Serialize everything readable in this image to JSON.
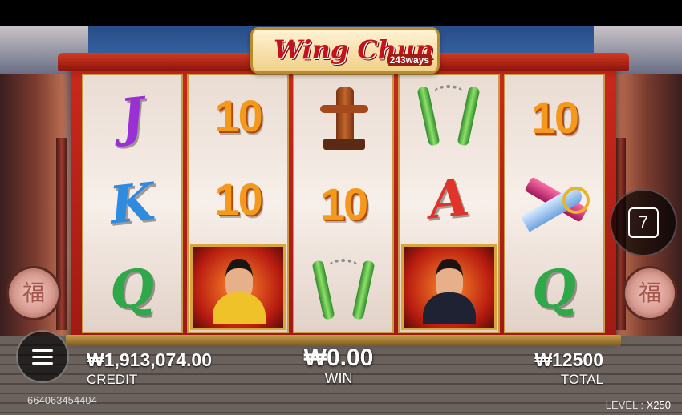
{
  "title": {
    "name": "Wing Chun",
    "ways": "243ways"
  },
  "reels": [
    [
      {
        "type": "letter",
        "text": "J",
        "color": "#9b2fd6"
      },
      {
        "type": "letter",
        "text": "K",
        "color": "#2e8be0"
      },
      {
        "type": "letter",
        "text": "Q",
        "color": "#2fa84a"
      }
    ],
    [
      {
        "type": "number",
        "text": "10"
      },
      {
        "type": "number",
        "text": "10"
      },
      {
        "type": "portrait",
        "icon": "yellow-fighter-portrait-icon"
      }
    ],
    [
      {
        "type": "icon",
        "icon": "wooden-dummy-icon"
      },
      {
        "type": "number",
        "text": "10"
      },
      {
        "type": "icon",
        "icon": "nunchaku-icon"
      }
    ],
    [
      {
        "type": "icon",
        "icon": "nunchaku-icon"
      },
      {
        "type": "letter",
        "text": "A",
        "color": "#e0332a"
      },
      {
        "type": "portrait",
        "icon": "master-portrait-icon"
      }
    ],
    [
      {
        "type": "number",
        "text": "10"
      },
      {
        "type": "icon",
        "icon": "crossed-blades-icon"
      },
      {
        "type": "letter",
        "text": "Q",
        "color": "#2fa84a"
      }
    ]
  ],
  "autoplay": {
    "count": "7"
  },
  "balance": {
    "value": "₩1,913,074.00",
    "label": "CREDIT"
  },
  "win": {
    "value": "₩0.00",
    "label": "WIN"
  },
  "total": {
    "value": "₩12500",
    "label": "TOTAL"
  },
  "session_id": "664063454404",
  "level": {
    "label": "LEVEL :",
    "value": "X250"
  },
  "colors": {
    "frame_red": "#c8281a",
    "gold": "#d9a63b"
  }
}
